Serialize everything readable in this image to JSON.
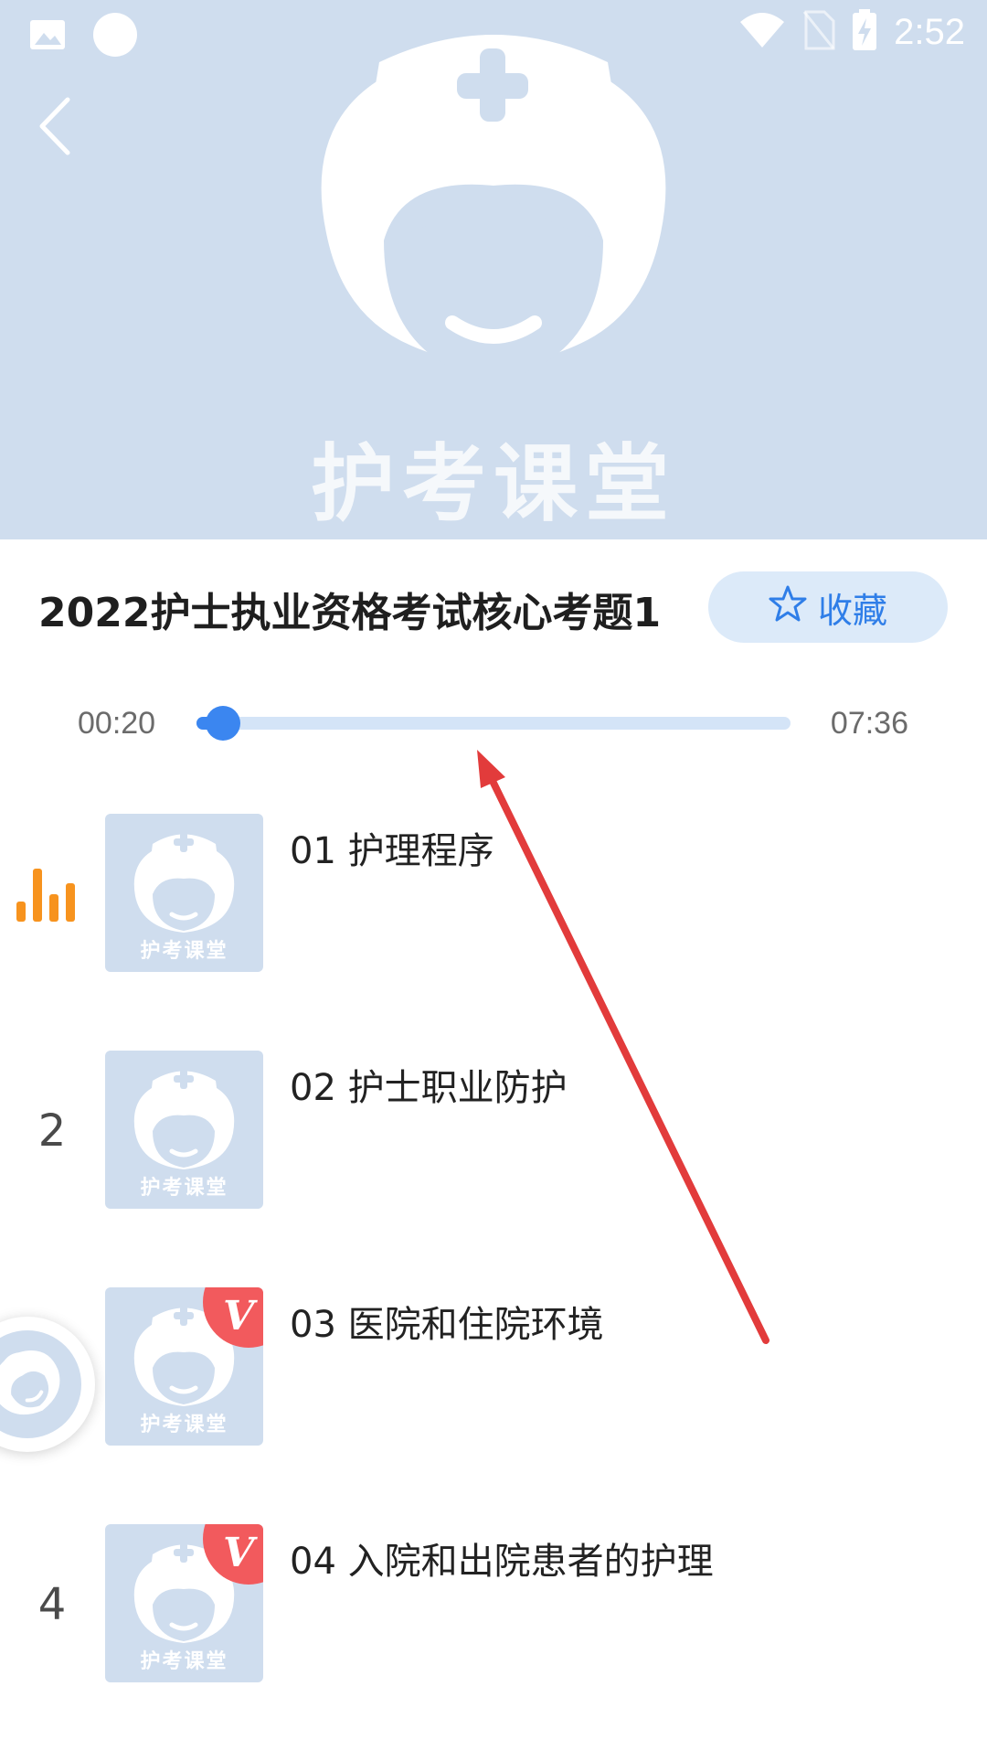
{
  "status_bar": {
    "time": "2:52",
    "icons": [
      "image-icon",
      "circle-icon",
      "wifi-icon",
      "no-sim-icon",
      "battery-charging-icon"
    ]
  },
  "header": {
    "back_icon": "chevron-left-icon",
    "brand_text": "护考课堂",
    "background_color": "#cfddee"
  },
  "track": {
    "title": "2022护士执业资格考试核心考题1",
    "favorite_label": "收藏",
    "favorite_icon": "star-outline-icon"
  },
  "progress": {
    "current": "00:20",
    "total": "07:36",
    "fraction": 0.044,
    "accent_color": "#3b86f0"
  },
  "lessons": [
    {
      "index": "",
      "playing": true,
      "title": "01 护理程序",
      "thumb_brand": "护考课堂",
      "vip": false
    },
    {
      "index": "2",
      "playing": false,
      "title": "02 护士职业防护",
      "thumb_brand": "护考课堂",
      "vip": false
    },
    {
      "index": "",
      "playing": false,
      "title": "03 医院和住院环境",
      "thumb_brand": "护考课堂",
      "vip": true,
      "vip_label": "V"
    },
    {
      "index": "4",
      "playing": false,
      "title": "04 入院和出院患者的护理",
      "thumb_brand": "护考课堂",
      "vip": true,
      "vip_label": "V"
    }
  ],
  "floating_player": {
    "icon": "mini-player-icon"
  },
  "colors": {
    "vip_badge": "#f25a5d",
    "playing_indicator": "#f7931e",
    "annotation_arrow": "#e23b3b"
  }
}
